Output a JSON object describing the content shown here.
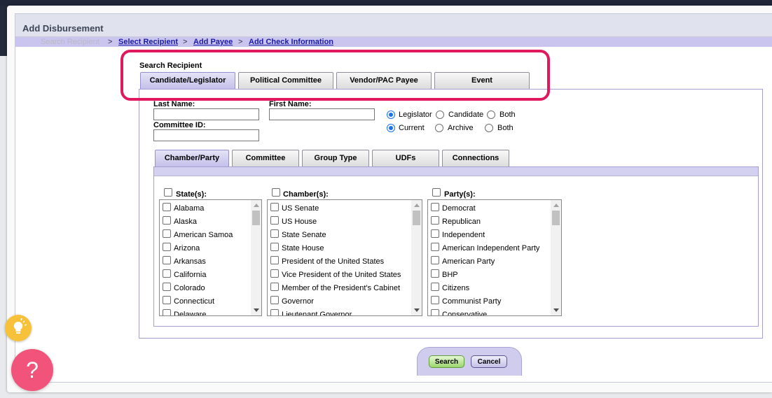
{
  "window": {
    "title": "Add Disbursement"
  },
  "breadcrumb": {
    "step1": "Search Recipient",
    "step2": "Select Recipient",
    "step3": "Add Payee",
    "step4": "Add Check Information",
    "separator": ">"
  },
  "search": {
    "label": "Search Recipient",
    "tabs": [
      "Candidate/Legislator",
      "Political Committee",
      "Vendor/PAC Payee",
      "Event"
    ],
    "active_tab": "Candidate/Legislator"
  },
  "fields": {
    "last_name_label": "Last Name:",
    "last_name_value": "",
    "first_name_label": "First Name:",
    "first_name_value": "",
    "committee_id_label": "Committee ID:",
    "committee_id_value": ""
  },
  "radios": {
    "type": {
      "options": [
        "Legislator",
        "Candidate",
        "Both"
      ],
      "selected": "Legislator"
    },
    "status": {
      "options": [
        "Current",
        "Archive",
        "Both"
      ],
      "selected": "Current"
    }
  },
  "subtabs": {
    "labels": [
      "Chamber/Party",
      "Committee",
      "Group Type",
      "UDFs",
      "Connections"
    ],
    "active": "Chamber/Party"
  },
  "lists": {
    "states": {
      "header": "State(s):",
      "items": [
        "Alabama",
        "Alaska",
        "American Samoa",
        "Arizona",
        "Arkansas",
        "California",
        "Colorado",
        "Connecticut",
        "Delaware"
      ]
    },
    "chambers": {
      "header": "Chamber(s):",
      "items": [
        "US Senate",
        "US House",
        "State Senate",
        "State House",
        "President of the United States",
        "Vice President of the United States",
        "Member of the President's Cabinet",
        "Governor",
        "Lieutenant Governor"
      ]
    },
    "parties": {
      "header": "Party(s):",
      "items": [
        "Democrat",
        "Republican",
        "Independent",
        "American Independent Party",
        "American Party",
        "BHP",
        "Citizens",
        "Communist Party",
        "Conservative"
      ]
    }
  },
  "buttons": {
    "search": "Search",
    "cancel": "Cancel"
  },
  "help": {
    "label": "?"
  },
  "colors": {
    "highlight": "#e0195e",
    "accent": "#1a73e8",
    "help": "#f2537a",
    "bulb": "#f7c23a"
  },
  "icons": {
    "bulb": "lightbulb-icon",
    "help": "question-icon"
  }
}
